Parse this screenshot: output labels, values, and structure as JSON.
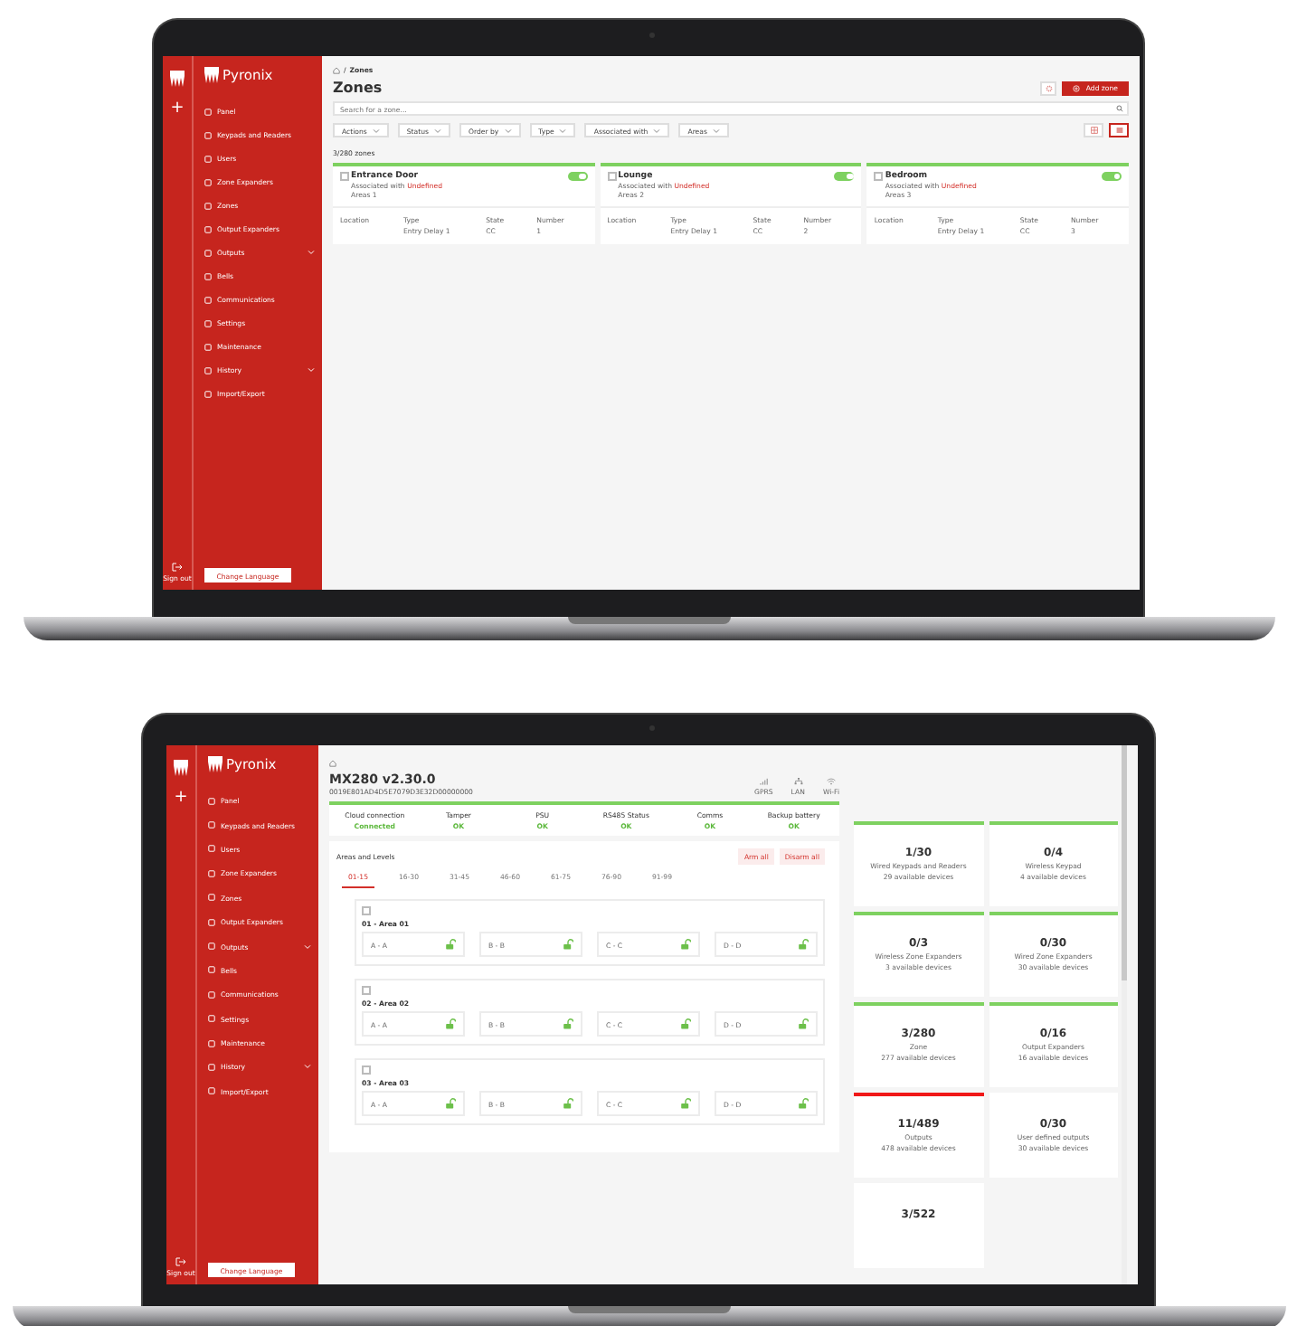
{
  "zones_screen": {
    "sidebar": {
      "add": "+",
      "brand": "Pyronix",
      "items": [
        {
          "label": "Panel",
          "expandable": false
        },
        {
          "label": "Keypads and Readers",
          "expandable": false
        },
        {
          "label": "Users",
          "expandable": false
        },
        {
          "label": "Zone Expanders",
          "expandable": false
        },
        {
          "label": "Zones",
          "expandable": false
        },
        {
          "label": "Output Expanders",
          "expandable": false
        },
        {
          "label": "Outputs",
          "expandable": true
        },
        {
          "label": "Bells",
          "expandable": false
        },
        {
          "label": "Communications",
          "expandable": false
        },
        {
          "label": "Settings",
          "expandable": false
        },
        {
          "label": "Maintenance",
          "expandable": false
        },
        {
          "label": "History",
          "expandable": true
        },
        {
          "label": "Import/Export",
          "expandable": false
        }
      ],
      "sign_out": "Sign out",
      "language_button": "Change Language"
    },
    "breadcrumb": {
      "separator": "/",
      "current": "Zones"
    },
    "title": "Zones",
    "add_button": "Add zone",
    "search": {
      "placeholder": "Search for a zone..."
    },
    "filters": [
      "Actions",
      "Status",
      "Order by",
      "Type",
      "Associated with",
      "Areas"
    ],
    "views": [
      {
        "kind": "grid",
        "selected": false
      },
      {
        "kind": "list",
        "selected": true
      }
    ],
    "count": "3/280 zones",
    "cards": [
      {
        "name": "Entrance Door",
        "checked": false,
        "enabled": true,
        "associated_label": "Associated with",
        "associated_value": "Undefined",
        "areas": "Areas 1",
        "fields": [
          {
            "label": "Location"
          },
          {
            "label": "Type",
            "value": "Entry Delay 1"
          },
          {
            "label": "State",
            "value": "CC"
          },
          {
            "label": "Number",
            "value": "1"
          }
        ]
      },
      {
        "name": "Lounge",
        "checked": false,
        "enabled": true,
        "associated_label": "Associated with",
        "associated_value": "Undefined",
        "areas": "Areas 2",
        "fields": [
          {
            "label": "Location"
          },
          {
            "label": "Type",
            "value": "Entry Delay 1"
          },
          {
            "label": "State",
            "value": "CC"
          },
          {
            "label": "Number",
            "value": "2"
          }
        ]
      },
      {
        "name": "Bedroom",
        "checked": false,
        "enabled": true,
        "associated_label": "Associated with",
        "associated_value": "Undefined",
        "areas": "Areas 3",
        "fields": [
          {
            "label": "Location"
          },
          {
            "label": "Type",
            "value": "Entry Delay 1"
          },
          {
            "label": "State",
            "value": "CC"
          },
          {
            "label": "Number",
            "value": "3"
          }
        ]
      }
    ]
  },
  "dashboard_screen": {
    "sidebar": {
      "add": "+",
      "brand": "Pyronix",
      "items": [
        {
          "label": "Panel",
          "expandable": false
        },
        {
          "label": "Keypads and Readers",
          "expandable": false
        },
        {
          "label": "Users",
          "expandable": false
        },
        {
          "label": "Zone Expanders",
          "expandable": false
        },
        {
          "label": "Zones",
          "expandable": false
        },
        {
          "label": "Output Expanders",
          "expandable": false
        },
        {
          "label": "Outputs",
          "expandable": true
        },
        {
          "label": "Bells",
          "expandable": false
        },
        {
          "label": "Communications",
          "expandable": false
        },
        {
          "label": "Settings",
          "expandable": false
        },
        {
          "label": "Maintenance",
          "expandable": false
        },
        {
          "label": "History",
          "expandable": true
        },
        {
          "label": "Import/Export",
          "expandable": false
        }
      ],
      "sign_out": "Sign out",
      "language_button": "Change Language"
    },
    "title": "MX280 v2.30.0",
    "serial": "0019E801AD4D5E7079D3E32D00000000",
    "connections": [
      {
        "kind": "gprs",
        "label": "GPRS"
      },
      {
        "kind": "lan",
        "label": "LAN"
      },
      {
        "kind": "wifi",
        "label": "Wi-Fi"
      }
    ],
    "statuses": [
      {
        "label": "Cloud connection",
        "value": "Connected"
      },
      {
        "label": "Tamper",
        "value": "OK"
      },
      {
        "label": "PSU",
        "value": "OK"
      },
      {
        "label": "RS485 Status",
        "value": "OK"
      },
      {
        "label": "Comms",
        "value": "OK"
      },
      {
        "label": "Backup battery",
        "value": "OK"
      }
    ],
    "areas_title": "Areas and Levels",
    "arm_all": "Arm all",
    "disarm_all": "Disarm all",
    "tabs": [
      {
        "label": "01-15",
        "selected": true
      },
      {
        "label": "16-30",
        "selected": false
      },
      {
        "label": "31-45",
        "selected": false
      },
      {
        "label": "46-60",
        "selected": false
      },
      {
        "label": "61-75",
        "selected": false
      },
      {
        "label": "76-90",
        "selected": false
      },
      {
        "label": "91-99",
        "selected": false
      }
    ],
    "areas": [
      {
        "name": "01 - Area 01",
        "checked": false,
        "levels": [
          {
            "label": "A - A",
            "locked": false
          },
          {
            "label": "B - B",
            "locked": false
          },
          {
            "label": "C - C",
            "locked": false
          },
          {
            "label": "D - D",
            "locked": false
          }
        ]
      },
      {
        "name": "02 - Area 02",
        "checked": false,
        "levels": [
          {
            "label": "A - A",
            "locked": false
          },
          {
            "label": "B - B",
            "locked": false
          },
          {
            "label": "C - C",
            "locked": false
          },
          {
            "label": "D - D",
            "locked": false
          }
        ]
      },
      {
        "name": "03 - Area 03",
        "checked": false,
        "levels": [
          {
            "label": "A - A",
            "locked": false
          },
          {
            "label": "B - B",
            "locked": false
          },
          {
            "label": "C - C",
            "locked": false
          },
          {
            "label": "D - D",
            "locked": false
          }
        ]
      }
    ],
    "tiles": [
      {
        "count": "1/30",
        "name": "Wired Keypads and Readers",
        "available": "29 available devices",
        "color": "#7ed160"
      },
      {
        "count": "0/4",
        "name": "Wireless Keypad",
        "available": "4 available devices",
        "color": "#7ed160"
      },
      {
        "count": "0/3",
        "name": "Wireless Zone Expanders",
        "available": "3 available devices",
        "color": "#7ed160"
      },
      {
        "count": "0/30",
        "name": "Wired Zone Expanders",
        "available": "30 available devices",
        "color": "#7ed160"
      },
      {
        "count": "3/280",
        "name": "Zone",
        "available": "277 available devices",
        "color": "#7ed160"
      },
      {
        "count": "0/16",
        "name": "Output Expanders",
        "available": "16 available devices",
        "color": "#7ed160"
      },
      {
        "count": "11/489",
        "name": "Outputs",
        "available": "478 available devices",
        "color": "#f01818"
      },
      {
        "count": "0/30",
        "name": "User defined outputs",
        "available": "30 available devices"
      },
      {
        "count": "3/522"
      }
    ]
  }
}
